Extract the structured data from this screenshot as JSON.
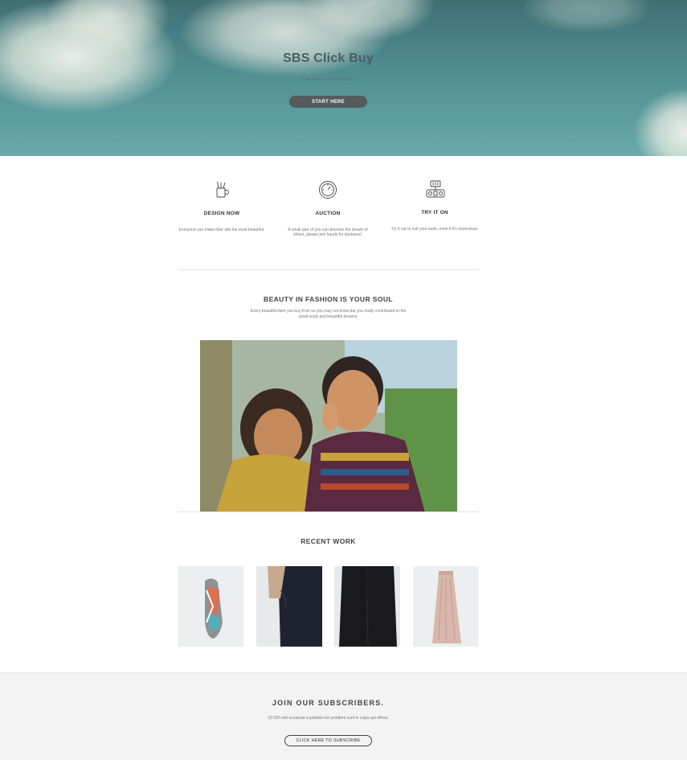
{
  "hero": {
    "title": "SBS Click Buy",
    "subtitle": "Lets sell together for charity!",
    "button_label": "START HERE"
  },
  "features": [
    {
      "icon": "mug-pencils-icon",
      "title": "DESIGN NOW",
      "description": "Everyone can make their site the most beautiful."
    },
    {
      "icon": "speedometer-icon",
      "title": "AUCTION",
      "description": "A small part of you can become the dream of others, please join hands for kindness!."
    },
    {
      "icon": "robot-icon",
      "title": "TRY IT ON",
      "description": "Try it out to suit your taste, even if it's meticulous."
    }
  ],
  "beauty": {
    "title": "BEAUTY IN FASHION IS YOUR SOUL",
    "description": "Every beautiful item you buy from us you may not know but you really contributed to the small souls and beautiful dreams."
  },
  "recent_work": {
    "title": "RECENT WORK",
    "items": [
      "sneaker",
      "black-pants",
      "black-jacket",
      "pink-skirt"
    ]
  },
  "subscribe": {
    "title": "JOIN OUR SUBSCRIBERS.",
    "description": "10 000 sint occaecat cupidatat non proident sunt in culpa qui officia.",
    "button_label": "CLICK HERE TO SUBSCRIBE"
  },
  "colors": {
    "hero_sky": "#4e8a8e",
    "button_dark": "#555a5b",
    "footer_bg": "#f3f3f3"
  }
}
